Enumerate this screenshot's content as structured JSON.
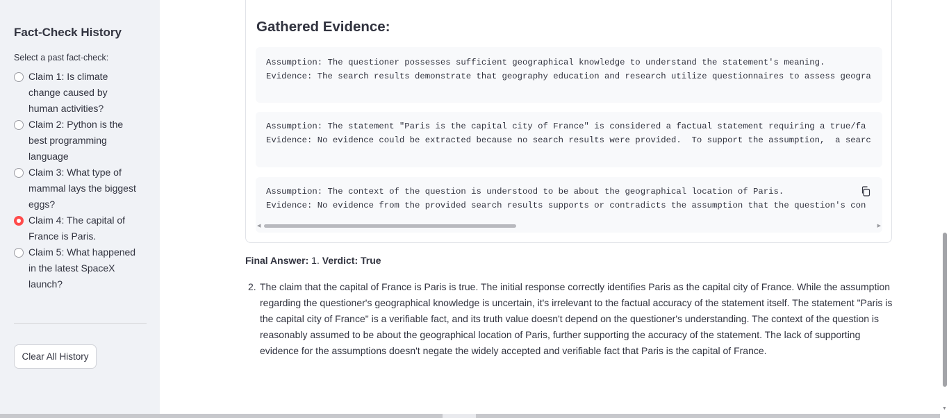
{
  "sidebar": {
    "title": "Fact-Check History",
    "select_label": "Select a past fact-check:",
    "options": [
      {
        "label": "Claim 1: Is climate change caused by human activities?",
        "checked": false
      },
      {
        "label": "Claim 2: Python is the best programming language",
        "checked": false
      },
      {
        "label": "Claim 3: What type of mammal lays the biggest eggs?",
        "checked": false
      },
      {
        "label": "Claim 4: The capital of France is Paris.",
        "checked": true
      },
      {
        "label": "Claim 5: What happened in the latest SpaceX launch?",
        "checked": false
      }
    ],
    "clear_button": "Clear All History"
  },
  "evidence": {
    "heading": "Gathered Evidence:",
    "blocks": [
      {
        "assumption": "Assumption: The questioner possesses sufficient geographical knowledge to understand the statement's meaning.",
        "evidence": "Evidence: The search results demonstrate that geography education and research utilize questionnaires to assess geogra"
      },
      {
        "assumption": "Assumption: The statement \"Paris is the capital city of France\" is considered a factual statement requiring a true/fa",
        "evidence": "Evidence: No evidence could be extracted because no search results were provided.  To support the assumption,  a searc"
      },
      {
        "assumption": "Assumption: The context of the question is understood to be about the geographical location of Paris.",
        "evidence": "Evidence: No evidence from the provided search results supports or contradicts the assumption that the question's con"
      }
    ]
  },
  "final_answer": {
    "label": "Final Answer:",
    "number": "1.",
    "verdict": "Verdict: True",
    "item_number": "2.",
    "explanation": "The claim that the capital of France is Paris is true. The initial response correctly identifies Paris as the capital city of France. While the assumption regarding the questioner's geographical knowledge is uncertain, it's irrelevant to the factual accuracy of the statement itself. The statement \"Paris is the capital city of France\" is a verifiable fact, and its truth value doesn't depend on the questioner's understanding. The context of the question is reasonably assumed to be about the geographical location of Paris, further supporting the accuracy of the statement. The lack of supporting evidence for the assumptions doesn't negate the widely accepted and verifiable fact that Paris is the capital of France."
  },
  "colors": {
    "accent": "#ff4b4b",
    "sidebar_bg": "#f0f2f6",
    "code_bg": "#f8f9fb"
  },
  "icons": {
    "copy": "copy-icon"
  }
}
